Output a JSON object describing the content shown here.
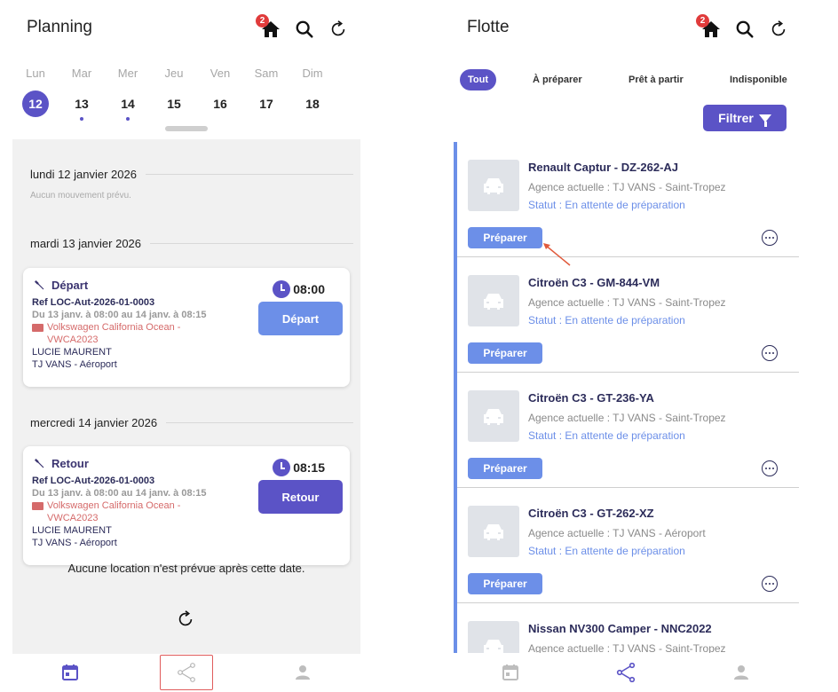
{
  "planning": {
    "title": "Planning",
    "badge_count": "2",
    "week": [
      {
        "name": "Lun",
        "num": "12",
        "selected": true,
        "dot": false
      },
      {
        "name": "Mar",
        "num": "13",
        "selected": false,
        "dot": true
      },
      {
        "name": "Mer",
        "num": "14",
        "selected": false,
        "dot": true
      },
      {
        "name": "Jeu",
        "num": "15",
        "selected": false,
        "dot": false
      },
      {
        "name": "Ven",
        "num": "16",
        "selected": false,
        "dot": false
      },
      {
        "name": "Sam",
        "num": "17",
        "selected": false,
        "dot": false
      },
      {
        "name": "Dim",
        "num": "18",
        "selected": false,
        "dot": false
      }
    ],
    "days": [
      {
        "heading": "lundi 12 janvier 2026",
        "empty": "Aucun mouvement prévu."
      },
      {
        "heading": "mardi 13 janvier 2026"
      },
      {
        "heading": "mercredi 14 janvier 2026"
      }
    ],
    "cards": [
      {
        "type": "Départ",
        "time": "08:00",
        "ref": "Ref LOC-Aut-2026-01-0003",
        "dates": "Du 13 janv. à 08:00 au 14 janv. à 08:15",
        "vehicle_line1": "Volkswagen California Ocean -",
        "vehicle_line2": "VWCA2023",
        "customer": "LUCIE MAURENT",
        "agency": "TJ VANS - Aéroport",
        "button": "Départ"
      },
      {
        "type": "Retour",
        "time": "08:15",
        "ref": "Ref LOC-Aut-2026-01-0003",
        "dates": "Du 13 janv. à 08:00 au 14 janv. à 08:15",
        "vehicle_line1": "Volkswagen California Ocean -",
        "vehicle_line2": "VWCA2023",
        "customer": "LUCIE MAURENT",
        "agency": "TJ VANS - Aéroport",
        "button": "Retour"
      }
    ],
    "end_note": "Aucune location n'est prévue après cette date."
  },
  "fleet": {
    "title": "Flotte",
    "badge_count": "2",
    "filters": [
      "Tout",
      "À préparer",
      "Prêt à partir",
      "Indisponible"
    ],
    "filter_button": "Filtrer",
    "vehicles": [
      {
        "name": "Renault Captur - DZ-262-AJ",
        "agency": "Agence actuelle : TJ VANS - Saint-Tropez",
        "status": "Statut : En attente de préparation",
        "action": "Préparer"
      },
      {
        "name": "Citroën C3 - GM-844-VM",
        "agency": "Agence actuelle : TJ VANS - Saint-Tropez",
        "status": "Statut : En attente de préparation",
        "action": "Préparer"
      },
      {
        "name": "Citroën C3 - GT-236-YA",
        "agency": "Agence actuelle : TJ VANS - Saint-Tropez",
        "status": "Statut : En attente de préparation",
        "action": "Préparer"
      },
      {
        "name": "Citroën C3 - GT-262-XZ",
        "agency": "Agence actuelle : TJ VANS - Aéroport",
        "status": "Statut : En attente de préparation",
        "action": "Préparer"
      },
      {
        "name": "Nissan NV300 Camper - NNC2022",
        "agency": "Agence actuelle : TJ VANS - Saint-Tropez",
        "status": "",
        "action": ""
      }
    ]
  },
  "colors": {
    "primary": "#5b53c6",
    "accent_blue": "#6c8fe8",
    "badge_red": "#e03b3b",
    "vehicle_red": "#d56a6a"
  },
  "icons": [
    "home-icon",
    "search-icon",
    "refresh-icon",
    "wrench-icon",
    "clock-icon",
    "truck-icon",
    "calendar-icon",
    "share-icon",
    "user-icon",
    "car-icon",
    "more-icon",
    "funnel-icon"
  ]
}
